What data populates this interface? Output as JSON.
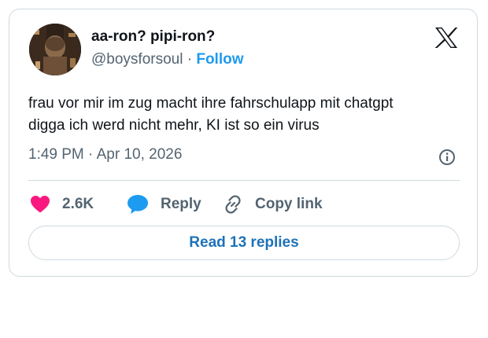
{
  "author": {
    "display_name": "aa-ron? pipi-ron?",
    "handle": "@boysforsoul",
    "separator": "·",
    "follow_label": "Follow"
  },
  "tweet": {
    "text_lines": [
      "frau vor mir im zug macht ihre fahrschulapp mit chatgpt",
      "digga ich werd nicht mehr, KI ist so ein virus"
    ],
    "timestamp": "1:49 PM · Apr 10, 2026"
  },
  "actions": {
    "likes_count": "2.6K",
    "reply_label": "Reply",
    "copy_link_label": "Copy link"
  },
  "read_replies_label": "Read 13 replies",
  "icons": {
    "brand": "x-logo-icon",
    "info": "info-icon",
    "like": "heart-icon",
    "reply": "speech-bubble-icon",
    "copy": "link-icon"
  },
  "colors": {
    "heart": "#f91880",
    "reply_bubble": "#1d9bf0",
    "follow": "#1d9bf0",
    "read_replies": "#1d72b8",
    "secondary_text": "#536471",
    "primary_text": "#0f1419",
    "border": "#cfd9de"
  }
}
